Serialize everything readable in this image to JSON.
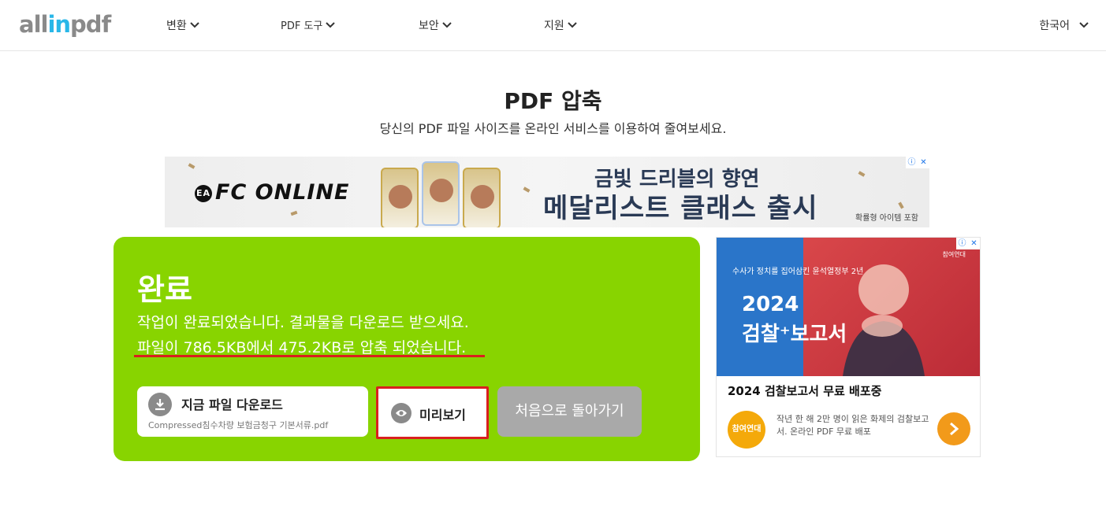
{
  "header": {
    "logo_a": "all",
    "logo_b": "in",
    "logo_c": "pdf",
    "nav": [
      {
        "label": "변환"
      },
      {
        "label": "PDF 도구"
      },
      {
        "label": "보안"
      },
      {
        "label": "지원"
      }
    ],
    "language": "한국어"
  },
  "page": {
    "title": "PDF 압축",
    "subtitle": "당신의 PDF 파일 사이즈를 온라인 서비스를 이용하여 줄여보세요."
  },
  "top_ad": {
    "brand": "FC ONLINE",
    "ea": "EA",
    "line1": "금빛 드리블의 향연",
    "line2": "메달리스트 클래스 출시",
    "note": "확률형 아이템 포함"
  },
  "result": {
    "status": "완료",
    "message": "작업이 완료되었습니다. 결과물을 다운로드 받으세요.",
    "compression": "파일이 786.5KB에서 475.2KB로 압축 되었습니다.",
    "download_label": "지금 파일 다운로드",
    "download_filename": "Compressed침수차량 보험금청구 기본서류.pdf",
    "preview_label": "미리보기",
    "restart_label": "처음으로 돌아가기"
  },
  "side_ad": {
    "small_text": "수사가 정치를 집어삼킨 윤석열정부 2년",
    "big1": "2024",
    "big2": "검찰⁺보고서",
    "publisher": "참여연대",
    "headline": "2024 검찰보고서 무료 배포중",
    "logo_text": "참여연대",
    "description": "작년 한 해 2만 명이 읽은 화제의 검찰보고서. 온라인 PDF 무료 배포"
  },
  "colors": {
    "accent_green": "#88d400",
    "highlight_red": "#d9201f",
    "logo_blue": "#29b7e8"
  }
}
